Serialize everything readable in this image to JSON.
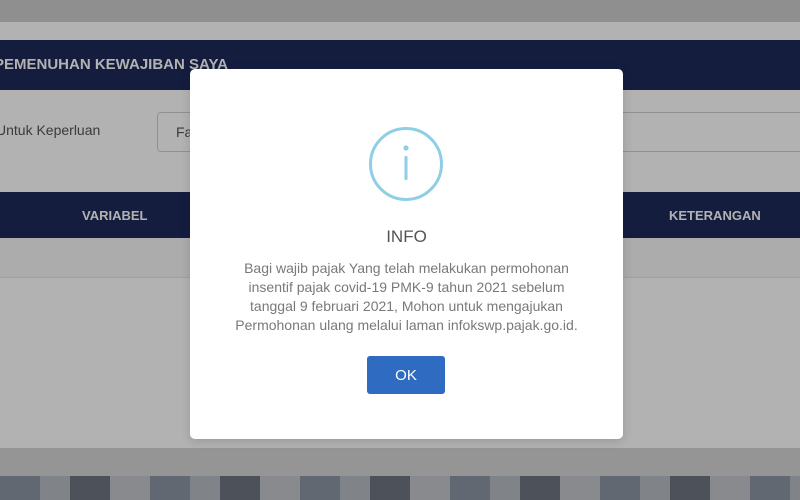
{
  "background": {
    "section_title": "PEMENUHAN KEWAJIBAN SAYA",
    "form_label": "Untuk Keperluan",
    "form_value": "Fa",
    "table_headers": [
      "VARIABEL",
      "KETERANGAN"
    ]
  },
  "modal": {
    "icon": "info-icon",
    "title": "INFO",
    "message_lines": [
      "Bagi wajib pajak Yang telah melakukan permohonan",
      "insentif pajak covid-19 PMK-9 tahun 2021 sebelum",
      "tanggal 9 februari 2021, Mohon untuk mengajukan",
      "Permohonan ulang melalui laman infokswp.pajak.go.id."
    ],
    "ok_label": "OK"
  },
  "colors": {
    "navy_header": "#1e2a5a",
    "icon_ring": "#8ecfe6",
    "button": "#2e6bc1"
  }
}
